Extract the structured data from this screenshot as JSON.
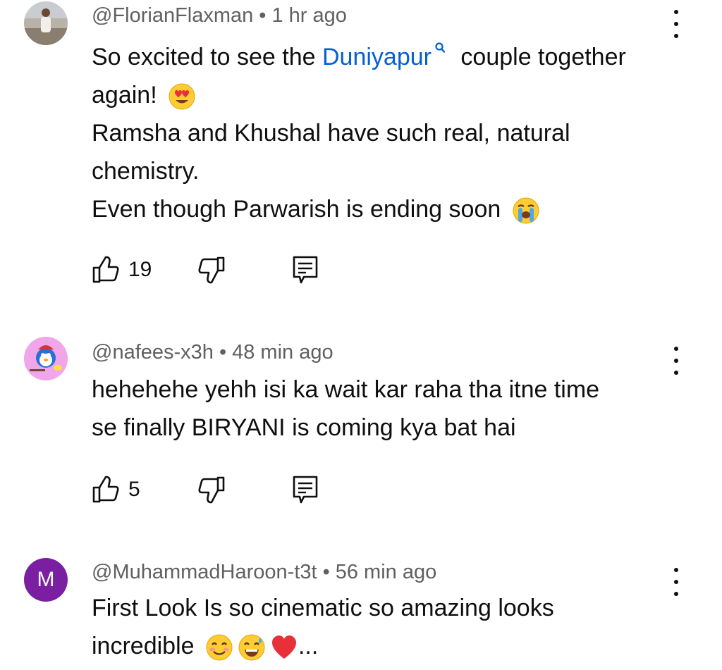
{
  "comments": [
    {
      "author": "@FlorianFlaxman",
      "time": "1 hr ago",
      "text_before": "So excited to see the ",
      "link": "Duniyapur",
      "text_after": " couple together",
      "line2": "again!",
      "line3": "Ramsha and Khushal have such real, natural",
      "line4": "chemistry.",
      "line5": "Even though Parwarish is ending soon",
      "likes": "19"
    },
    {
      "author": "@nafees-x3h",
      "time": "48 min ago",
      "line1": "hehehehe yehh isi ka wait kar raha tha itne time",
      "line2": "se finally BIRYANI is coming kya bat hai",
      "likes": "5"
    },
    {
      "author": "@MuhammadHaroon-t3t",
      "time": "56 min ago",
      "avatar_letter": "M",
      "line1": "First Look Is so cinematic so amazing looks",
      "line2": "incredible",
      "ellipsis": "..."
    }
  ],
  "separator": "•",
  "icons": [
    "thumbs-up-icon",
    "thumbs-down-icon",
    "reply-icon",
    "more-vert-icon",
    "search-link-icon"
  ],
  "colors": {
    "link": "#065fd4",
    "meta": "#606060",
    "avatar_m": "#7b1fa2"
  }
}
